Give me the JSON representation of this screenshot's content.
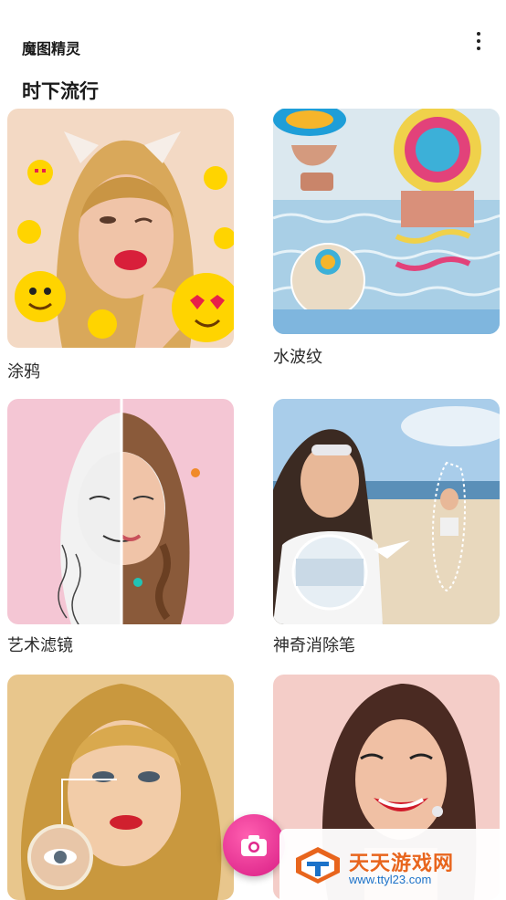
{
  "app": {
    "title": "魔图精灵"
  },
  "section": {
    "title": "时下流行"
  },
  "cards": [
    {
      "label": "涂鸦"
    },
    {
      "label": "水波纹"
    },
    {
      "label": "艺术滤镜"
    },
    {
      "label": "神奇消除笔"
    },
    {
      "label": ""
    },
    {
      "label": ""
    }
  ],
  "fab": {
    "icon": "camera-icon"
  },
  "watermark": {
    "name": "天天游戏网",
    "url": "www.ttyl23.com"
  },
  "colors": {
    "accent": "#e0298c",
    "watermark_orange": "#e8651d",
    "watermark_blue": "#1b72c9"
  }
}
